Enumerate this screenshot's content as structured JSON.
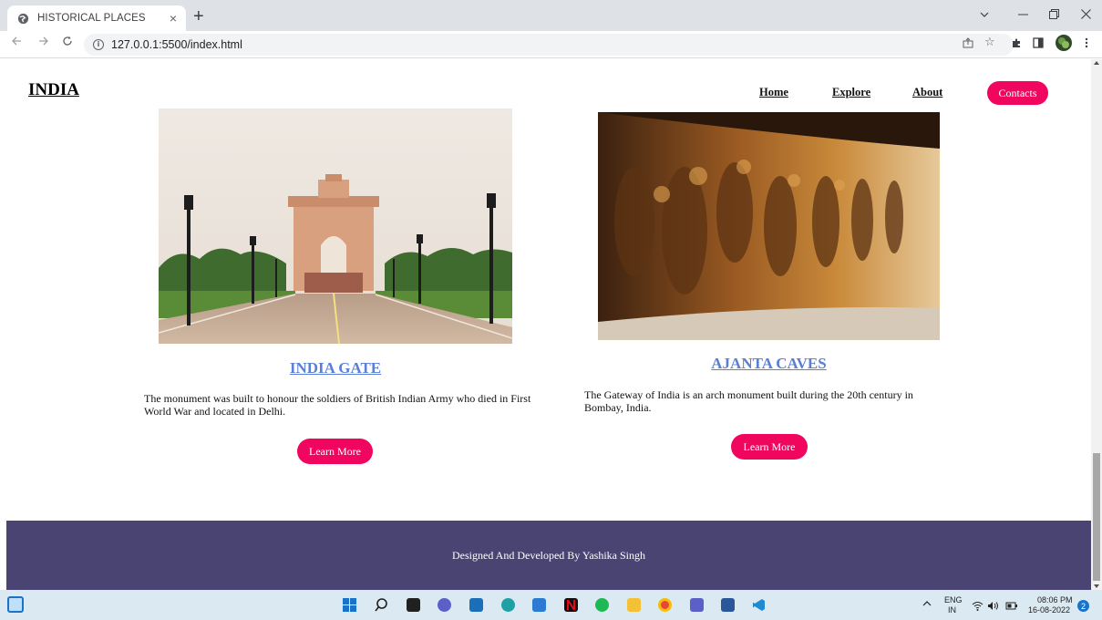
{
  "browser": {
    "tab_title": "HISTORICAL PLACES",
    "tab_close": "×",
    "new_tab": "+",
    "url": "127.0.0.1:5500/index.html"
  },
  "site": {
    "logo": "INDIA",
    "nav": {
      "home": "Home",
      "explore": "Explore",
      "about": "About",
      "contacts": "Contacts"
    },
    "cards": [
      {
        "title": "INDIA GATE",
        "text": "The monument was built to honour the soldiers of British Indian Army who died in First World War and located in Delhi.",
        "button": "Learn More"
      },
      {
        "title": "AJANTA CAVES",
        "text": "The Gateway of India is an arch monument built during the 20th century in Bombay, India.",
        "button": "Learn More"
      }
    ],
    "footer": "Designed And Developed By Yashika Singh"
  },
  "taskbar": {
    "lang_top": "ENG",
    "lang_bottom": "IN",
    "time": "08:06 PM",
    "date": "16-08-2022",
    "notification_count": "2"
  },
  "colors": {
    "accent": "#f0065f",
    "title_link": "#5a7fd6",
    "footer_bg": "#4a4472"
  }
}
